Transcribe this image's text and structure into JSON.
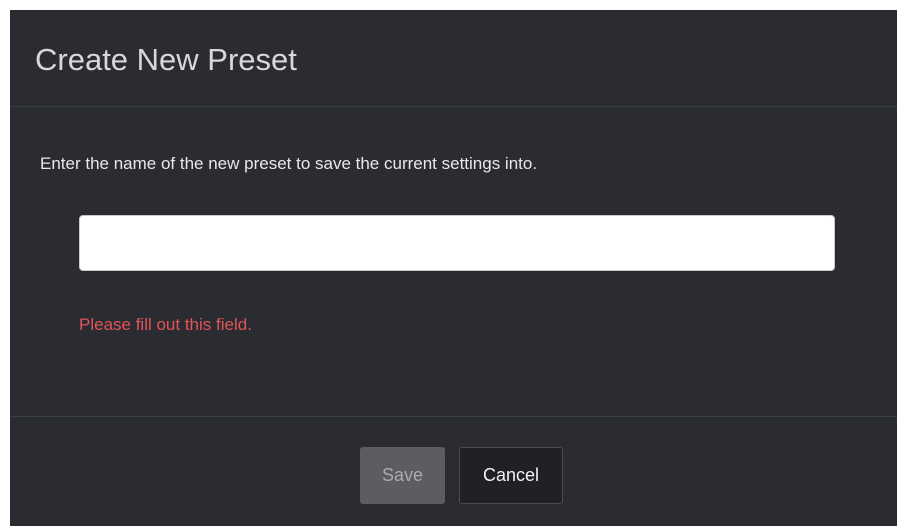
{
  "dialog": {
    "title": "Create New Preset",
    "description": "Enter the name of the new preset to save the current settings into.",
    "name_input": {
      "value": "",
      "placeholder": ""
    },
    "validation_message": "Please fill out this field.",
    "buttons": {
      "save_label": "Save",
      "cancel_label": "Cancel"
    }
  },
  "colors": {
    "dialog_background": "#2a2c31",
    "error_text": "#e0545a",
    "save_button_disabled": "#5b5d62",
    "cancel_button": "#1f2125"
  }
}
